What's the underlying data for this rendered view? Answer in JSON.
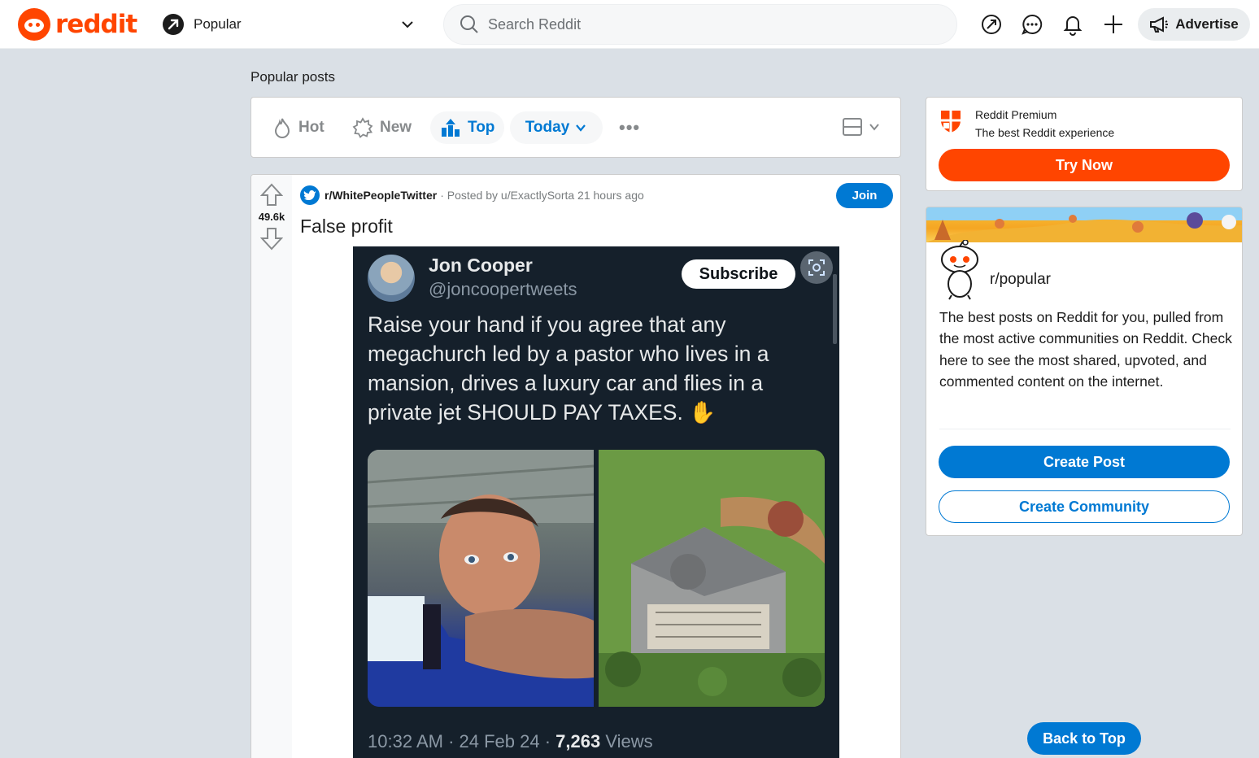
{
  "header": {
    "logo_text": "reddit",
    "feed_label": "Popular",
    "search_placeholder": "Search Reddit",
    "advertise_label": "Advertise"
  },
  "main": {
    "section_title": "Popular posts",
    "sort": {
      "hot": "Hot",
      "new": "New",
      "top": "Top",
      "time_range": "Today",
      "more": "•••"
    }
  },
  "post": {
    "score": "49.6k",
    "subreddit": "r/WhitePeopleTwitter",
    "meta": "· Posted by u/ExactlySorta 21 hours ago",
    "join_label": "Join",
    "title": "False profit",
    "tweet": {
      "name": "Jon Cooper",
      "handle": "@joncoopertweets",
      "subscribe_label": "Subscribe",
      "text": "Raise your hand if you agree that any megachurch led by a pastor who lives in a mansion, drives a luxury car and flies in a private jet SHOULD PAY TAXES. ✋",
      "time": "10:32 AM · 24 Feb 24 · ",
      "views_count": "7,263",
      "views_label": " Views"
    }
  },
  "sidebar": {
    "premium": {
      "title": "Reddit Premium",
      "subtitle": "The best Reddit experience",
      "cta": "Try Now"
    },
    "about": {
      "name": "r/popular",
      "description": "The best posts on Reddit for you, pulled from the most active communities on Reddit. Check here to see the most shared, upvoted, and commented content on the internet.",
      "create_post": "Create Post",
      "create_community": "Create Community"
    },
    "back_to_top": "Back to Top"
  },
  "colors": {
    "brand": "#ff4500",
    "accent": "#0079d3",
    "background": "#dae0e6"
  }
}
